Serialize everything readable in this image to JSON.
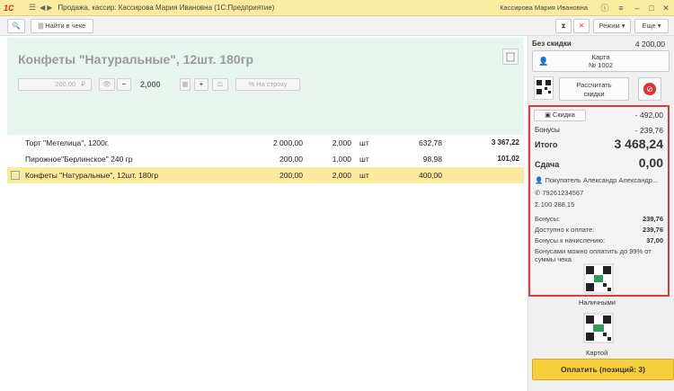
{
  "window": {
    "logo": "1С",
    "title": "Продажа, кассир: Кассирова Мария Ивановна  (1С:Предприятие)",
    "user": "Кассирова Мария Ивановна"
  },
  "toolbar": {
    "search_in_receipt": "Найти в чеке",
    "mode": "Режим",
    "more": "Еще"
  },
  "product": {
    "title": "Конфеты \"Натуральные\", 12шт. 180гр",
    "price_value": "200,00",
    "currency": "₽",
    "quantity": "2,000",
    "to_row": "На строку"
  },
  "receipt_rows": [
    {
      "name": "Торт \"Метелица\", 1200г.",
      "price": "2 000,00",
      "qty": "2,000",
      "unit": "шт",
      "sum": "632,78",
      "total": "3 367,22",
      "selected": false
    },
    {
      "name": "Пирожное\"Берлинское\" 240 гр",
      "price": "200,00",
      "qty": "1,000",
      "unit": "шт",
      "sum": "98,98",
      "total": "101,02",
      "selected": false
    },
    {
      "name": "Конфеты \"Натуральные\", 12шт. 180гр",
      "price": "200,00",
      "qty": "2,000",
      "unit": "шт",
      "sum": "400,00",
      "total": "",
      "selected": true
    }
  ],
  "right": {
    "no_discount_label": "Без скидки",
    "no_discount_value": "4 200,00",
    "card_label": "Карта",
    "card_number": "№ 1002",
    "calc_discounts": "Рассчитать скидки",
    "discount_label": "Скидка",
    "discount_value": "- 492,00",
    "bonus_label": "Бонусы",
    "bonus_value": "- 239,76",
    "total_label": "Итого",
    "total_value": "3 468,24",
    "change_label": "Сдача",
    "change_value": "0,00",
    "buyer": "Покупатель Александр Александр...",
    "phone": "79261234567",
    "balance": "100 288,15",
    "bonuses_label": "Бонусы:",
    "bonuses_value": "239,76",
    "available_label": "Доступно к оплате:",
    "available_value": "239,76",
    "accrual_label": "Бонусы к начислению:",
    "accrual_value": "37,00",
    "note": "Бонусами можно оплатить до 99% от суммы чека",
    "cash_label": "Наличными",
    "card_pay_label": "Картой",
    "pay_button": "Оплатить (позиций: 3)"
  },
  "colors": {
    "titlebar": "#fbeba0",
    "product_header": "#e8f5ef",
    "selected_row": "#faea9d",
    "summary_border": "#e03a3a",
    "pay_button": "#f7cf3a"
  }
}
